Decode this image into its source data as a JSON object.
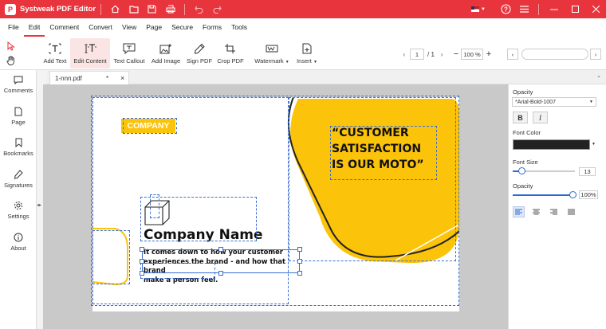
{
  "app": {
    "title": "Systweak PDF Editor",
    "logo_glyph": "P"
  },
  "menu": {
    "items": [
      "File",
      "Edit",
      "Comment",
      "Convert",
      "View",
      "Page",
      "Secure",
      "Forms",
      "Tools"
    ],
    "active": "Edit"
  },
  "ribbon": {
    "tools": [
      {
        "label": "Add Text",
        "icon": "add-text-icon"
      },
      {
        "label": "Edit Content",
        "icon": "edit-content-icon"
      },
      {
        "label": "Text Callout",
        "icon": "text-callout-icon"
      },
      {
        "label": "Add Image",
        "icon": "add-image-icon"
      },
      {
        "label": "Sign PDF",
        "icon": "sign-pdf-icon"
      },
      {
        "label": "Crop PDF",
        "icon": "crop-pdf-icon"
      },
      {
        "label": "Watermark",
        "icon": "watermark-icon"
      },
      {
        "label": "Insert",
        "icon": "insert-icon"
      }
    ],
    "page_current": "1",
    "page_total": "/ 1",
    "zoom": "100 %",
    "search_placeholder": ""
  },
  "tabs": [
    {
      "label": "1-nnn.pdf",
      "modified": "*"
    }
  ],
  "left_panel": {
    "items": [
      "Comments",
      "Page",
      "Bookmarks",
      "Signatures",
      "Settings",
      "About"
    ]
  },
  "document": {
    "company_badge": "COMPANY",
    "quote_line1": "“CUSTOMER",
    "quote_line2": "SATISFACTION",
    "quote_line3": "IS OUR MOTO”",
    "company_name": "Company Name",
    "body_line1": "It comes down to how your customer",
    "body_line2": "experiences the brand - and how that brand",
    "body_line3": "make a person feel."
  },
  "properties": {
    "opacity_label": "Opacity",
    "font_value": "*Arial-Bold-1007",
    "bold_label": "B",
    "italic_label": "I",
    "font_color_label": "Font Color",
    "font_color": "#222222",
    "font_size_label": "Font Size",
    "font_size": "13",
    "opacity2_label": "Opacity",
    "opacity_value": "100%",
    "opacity_fraction": 1.0,
    "font_size_fraction": 0.1
  },
  "colors": {
    "accent": "#e8343c",
    "yellow": "#fcc30b",
    "selection": "#3b6fd0"
  }
}
